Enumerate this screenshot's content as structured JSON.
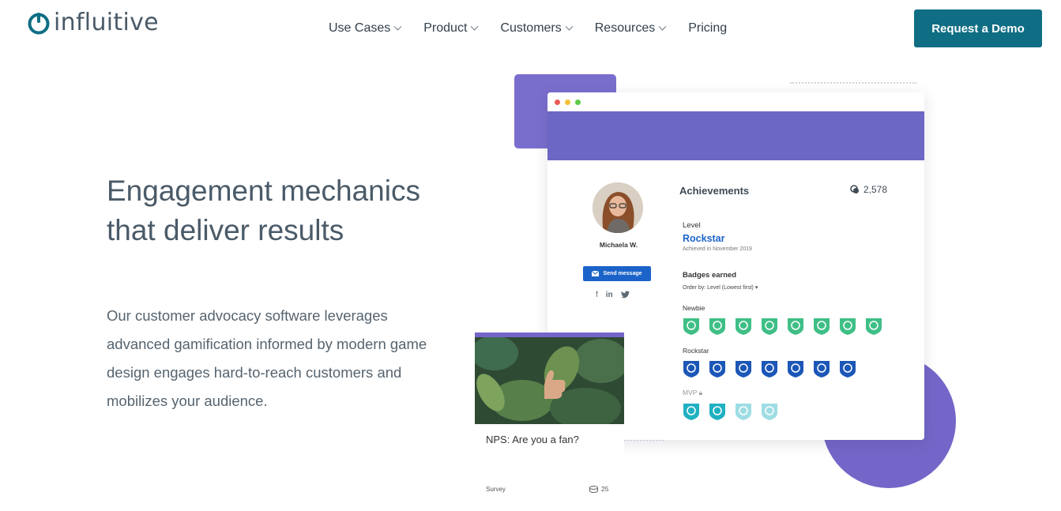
{
  "brand": {
    "name": "influitive",
    "accent": "#0f6e84",
    "purple": "#7366c8"
  },
  "nav": {
    "items": [
      {
        "label": "Use Cases",
        "has_dropdown": true
      },
      {
        "label": "Product",
        "has_dropdown": true
      },
      {
        "label": "Customers",
        "has_dropdown": true
      },
      {
        "label": "Resources",
        "has_dropdown": true
      },
      {
        "label": "Pricing",
        "has_dropdown": false
      }
    ],
    "cta_label": "Request a Demo"
  },
  "hero": {
    "title": "Engagement mechanics that deliver results",
    "description": "Our customer advocacy software leverages advanced gamification informed by modern game design engages hard-to-reach customers and mobilizes your audience."
  },
  "profile": {
    "name": "Michaela W.",
    "send_label": "Send message",
    "socials": [
      "facebook-icon",
      "linkedin-icon",
      "twitter-icon"
    ]
  },
  "achievements": {
    "title": "Achievements",
    "points": "2,578",
    "level_label": "Level",
    "level_value": "Rockstar",
    "level_sub": "Achieved in November 2019",
    "badges_label": "Badges earned",
    "order_by": "Order by: Level (Lowest first)",
    "groups": [
      {
        "name": "Newbie",
        "color": "#3fbf86",
        "count": 8
      },
      {
        "name": "Rockstar",
        "color": "#1c57b8",
        "count": 7
      },
      {
        "name": "MVP",
        "color": "#1fb1c2",
        "count": 4,
        "locked": true
      }
    ]
  },
  "card": {
    "title": "NPS: Are you a fan?",
    "type": "Survey",
    "points": "25"
  }
}
